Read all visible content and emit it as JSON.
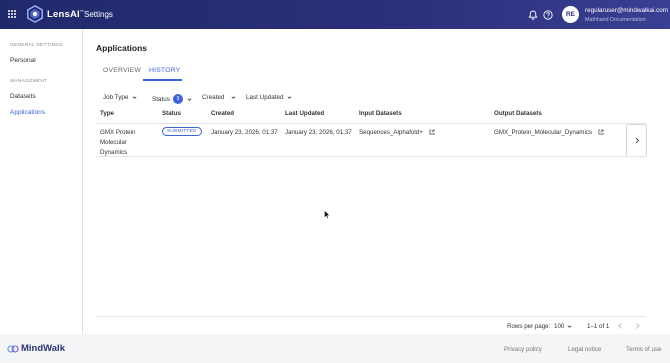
{
  "header": {
    "logo_text": "LensAI",
    "logo_sup": "™",
    "app_title": "Settings",
    "user_initials": "RE",
    "user_email": "regularuser@mindwalkai.com",
    "user_subtitle": "Mathhand Documentation"
  },
  "sidebar": {
    "section_general": "GENERAL SETTINGS",
    "item_personal": "Personal",
    "section_management": "MANAGEMENT",
    "item_datasets": "Datasets",
    "item_applications": "Applications"
  },
  "main": {
    "title": "Applications",
    "tabs": [
      {
        "label": "OVERVIEW",
        "active": false
      },
      {
        "label": "HISTORY",
        "active": true
      }
    ],
    "filters": {
      "job_type": "Job Type",
      "status": "Status",
      "status_count": "3",
      "created": "Created",
      "last_updated": "Last Updated"
    },
    "columns": [
      "Type",
      "Status",
      "Created",
      "Last Updated",
      "Input Datasets",
      "Output Datasets"
    ],
    "rows": [
      {
        "type_lines": [
          "GMX Protein",
          "Molecular",
          "Dynamics"
        ],
        "status": "SUBMITTED",
        "created": "January 23, 2026, 01:37",
        "last_updated": "January 23, 2026, 01:37",
        "input_dataset": "Sequences_Alphafold+",
        "output_dataset": "GMX_Protein_Molecular_Dynamics"
      }
    ],
    "pagination": {
      "rows_per_page_label": "Rows per page:",
      "rows_per_page": "100",
      "range": "1–1 of 1"
    }
  },
  "footer": {
    "brand": "MindWalk",
    "links": [
      "Privacy policy",
      "Legal notice",
      "Terms of use"
    ]
  },
  "colors": {
    "accent": "#3c63d6",
    "topbar": "#2c2f7a"
  }
}
